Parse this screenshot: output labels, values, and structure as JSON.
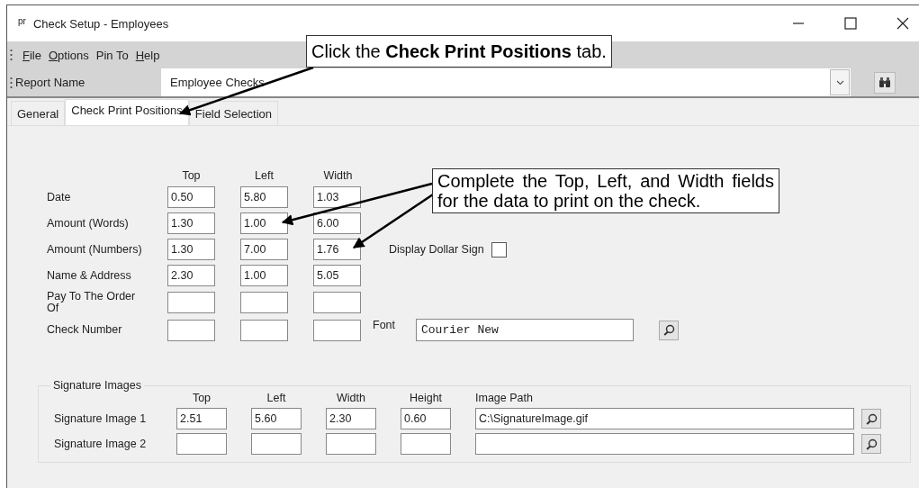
{
  "window": {
    "app_icon": "pr",
    "title": "Check Setup - Employees"
  },
  "menu": [
    {
      "underlined": "F",
      "rest": "ile"
    },
    {
      "underlined": "O",
      "rest": "ptions"
    },
    {
      "rest": "Pin To"
    },
    {
      "underlined": "H",
      "rest": "elp"
    }
  ],
  "report_name": {
    "label": "Report Name",
    "value": "Employee Checks"
  },
  "tabs": [
    {
      "label": "General",
      "selected": false
    },
    {
      "label": "Check Print Positions",
      "selected": true
    },
    {
      "label": "Field Selection",
      "selected": false
    }
  ],
  "positions": {
    "columns": [
      "Top",
      "Left",
      "Width"
    ],
    "rows": [
      {
        "label": "Date",
        "values": [
          "0.50",
          "5.80",
          "1.03"
        ]
      },
      {
        "label": "Amount (Words)",
        "values": [
          "1.30",
          "1.00",
          "6.00"
        ]
      },
      {
        "label": "Amount (Numbers)",
        "values": [
          "1.30",
          "7.00",
          "1.76"
        ]
      },
      {
        "label": "Name & Address",
        "values": [
          "2.30",
          "1.00",
          "5.05"
        ]
      },
      {
        "label": "Pay To The Order Of"
      },
      {
        "label": "Check Number"
      }
    ]
  },
  "display_dollar_sign": {
    "label": "Display Dollar Sign",
    "checked": false
  },
  "font": {
    "label": "Font",
    "value": "Courier New"
  },
  "signature_images": {
    "title": "Signature Images",
    "columns": [
      "Top",
      "Left",
      "Width",
      "Height",
      "Image Path"
    ],
    "rows": [
      {
        "label": "Signature Image 1",
        "values": [
          "2.51",
          "5.60",
          "2.30",
          "0.60",
          "C:\\SignatureImage.gif"
        ]
      },
      {
        "label": "Signature Image 2"
      }
    ]
  },
  "callouts": [
    {
      "text": "Click the **Check Print Positions** tab."
    },
    {
      "text": "Complete the Top, Left, and Width fields for the data to print on the check."
    }
  ]
}
